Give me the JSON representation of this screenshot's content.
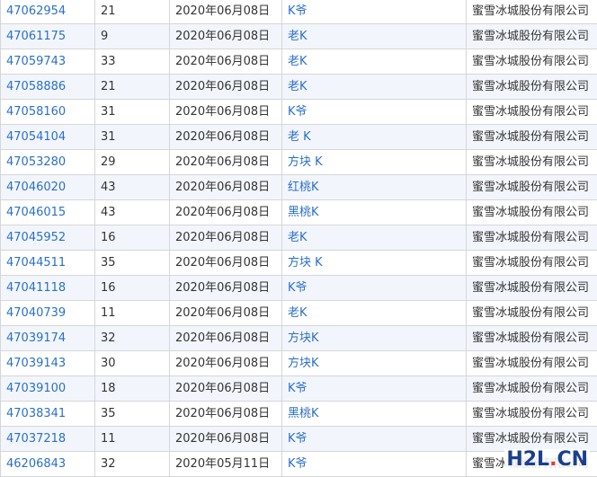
{
  "rows": [
    {
      "id": "47062954",
      "class": "21",
      "date": "2020年06月08日",
      "mark": "K爷",
      "applicant": "蜜雪冰城股份有限公司"
    },
    {
      "id": "47061175",
      "class": "9",
      "date": "2020年06月08日",
      "mark": "老K",
      "applicant": "蜜雪冰城股份有限公司"
    },
    {
      "id": "47059743",
      "class": "33",
      "date": "2020年06月08日",
      "mark": "老K",
      "applicant": "蜜雪冰城股份有限公司"
    },
    {
      "id": "47058886",
      "class": "21",
      "date": "2020年06月08日",
      "mark": "老K",
      "applicant": "蜜雪冰城股份有限公司"
    },
    {
      "id": "47058160",
      "class": "31",
      "date": "2020年06月08日",
      "mark": "K爷",
      "applicant": "蜜雪冰城股份有限公司"
    },
    {
      "id": "47054104",
      "class": "31",
      "date": "2020年06月08日",
      "mark": "老 K",
      "applicant": "蜜雪冰城股份有限公司"
    },
    {
      "id": "47053280",
      "class": "29",
      "date": "2020年06月08日",
      "mark": "方块 K",
      "applicant": "蜜雪冰城股份有限公司"
    },
    {
      "id": "47046020",
      "class": "43",
      "date": "2020年06月08日",
      "mark": "红桃K",
      "applicant": "蜜雪冰城股份有限公司"
    },
    {
      "id": "47046015",
      "class": "43",
      "date": "2020年06月08日",
      "mark": "黑桃K",
      "applicant": "蜜雪冰城股份有限公司"
    },
    {
      "id": "47045952",
      "class": "16",
      "date": "2020年06月08日",
      "mark": "老K",
      "applicant": "蜜雪冰城股份有限公司"
    },
    {
      "id": "47044511",
      "class": "35",
      "date": "2020年06月08日",
      "mark": "方块 K",
      "applicant": "蜜雪冰城股份有限公司"
    },
    {
      "id": "47041118",
      "class": "16",
      "date": "2020年06月08日",
      "mark": "K爷",
      "applicant": "蜜雪冰城股份有限公司"
    },
    {
      "id": "47040739",
      "class": "11",
      "date": "2020年06月08日",
      "mark": "老K",
      "applicant": "蜜雪冰城股份有限公司"
    },
    {
      "id": "47039174",
      "class": "32",
      "date": "2020年06月08日",
      "mark": "方块K",
      "applicant": "蜜雪冰城股份有限公司"
    },
    {
      "id": "47039143",
      "class": "30",
      "date": "2020年06月08日",
      "mark": "方块K",
      "applicant": "蜜雪冰城股份有限公司"
    },
    {
      "id": "47039100",
      "class": "18",
      "date": "2020年06月08日",
      "mark": "K爷",
      "applicant": "蜜雪冰城股份有限公司"
    },
    {
      "id": "47038341",
      "class": "35",
      "date": "2020年06月08日",
      "mark": "黑桃K",
      "applicant": "蜜雪冰城股份有限公司"
    },
    {
      "id": "47037218",
      "class": "11",
      "date": "2020年06月08日",
      "mark": "K爷",
      "applicant": "蜜雪冰城股份有限公司"
    },
    {
      "id": "46206843",
      "class": "32",
      "date": "2020年05月11日",
      "mark": "K爷",
      "applicant": "蜜雪冰城股份有限公司"
    }
  ],
  "watermark": {
    "text_main": "H2L",
    "text_dot": ".",
    "text_end": "CN"
  },
  "colors": {
    "link": "#2a6fc9",
    "row_alt": "#f2f6fc",
    "border": "#d6d6d6",
    "watermark": "#1a3f8f"
  }
}
